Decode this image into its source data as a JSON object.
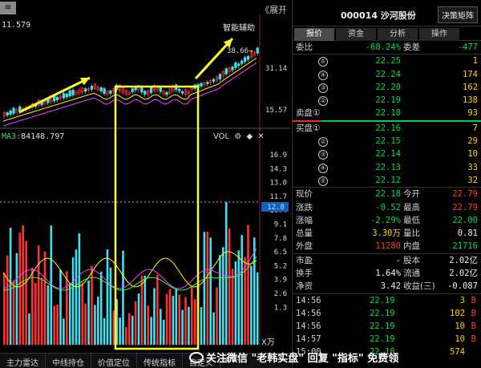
{
  "chart": {
    "menu_icon": "menu-icon",
    "expand_label": "《展开",
    "price_readout": "11.579",
    "assist_label": "智能辅助",
    "peak_label": "38.66→",
    "price_axis": [
      "31.14",
      "15.57"
    ],
    "ma_tag": "MA3:",
    "ma_value": "84148.797",
    "vol_tag": "VOL",
    "volume_axis": [
      "16.9",
      "14.3",
      "13.0",
      "11.7",
      "10.4",
      "9.1",
      "7.8",
      "6.5",
      "5.2",
      "3.9",
      "2.6",
      "1.3"
    ],
    "volume_highlight": "12.8",
    "unit_label": "X万",
    "colors": {
      "up": "#ff3030",
      "down": "#40e0f0",
      "ma1": "#ffff00",
      "ma2": "#ff40ff",
      "ma3": "#40ff40",
      "box": "#ffff30",
      "arrow": "#ffff30"
    }
  },
  "tabs": [
    "主力雷达",
    "中线持仓",
    "价值定位",
    "传统指标",
    "自定义"
  ],
  "tab_arrows": [
    "◀",
    "▶"
  ],
  "panel": {
    "title": "000014 沙河股份",
    "decision_btn": "决策矩阵",
    "tabs": [
      "报价",
      "资金",
      "分析",
      "操作"
    ],
    "ratio": {
      "label1": "委比",
      "value1": "-68.24%",
      "label2": "委差",
      "value2": "-477"
    },
    "sell": [
      {
        "n": "⑤",
        "price": "22.25",
        "vol": "1"
      },
      {
        "n": "④",
        "price": "22.24",
        "vol": "174"
      },
      {
        "n": "③",
        "price": "22.20",
        "vol": "162"
      },
      {
        "n": "②",
        "price": "22.19",
        "vol": "138"
      },
      {
        "label": "卖盘①",
        "price": "22.18",
        "vol": "93"
      }
    ],
    "buy": [
      {
        "label": "买盘①",
        "price": "22.16",
        "vol": "7"
      },
      {
        "n": "②",
        "price": "22.15",
        "vol": "29"
      },
      {
        "n": "③",
        "price": "22.14",
        "vol": "10"
      },
      {
        "n": "④",
        "price": "22.13",
        "vol": "33"
      },
      {
        "n": "⑤",
        "price": "22.12",
        "vol": "32"
      }
    ],
    "stats": [
      {
        "l1": "现价",
        "v1": "22.18",
        "c1": "green",
        "l2": "今开",
        "v2": "22.79",
        "c2": "red"
      },
      {
        "l1": "涨跌",
        "v1": "-0.52",
        "c1": "green",
        "l2": "最高",
        "v2": "22.79",
        "c2": "red"
      },
      {
        "l1": "涨幅",
        "v1": "-2.29%",
        "c1": "green",
        "l2": "最低",
        "v2": "22.00",
        "c2": "green"
      },
      {
        "l1": "总量",
        "v1": "3.30万",
        "c1": "yellow",
        "l2": "量比",
        "v2": "0.81",
        "c2": "white"
      },
      {
        "l1": "外盘",
        "v1": "11280",
        "c1": "red",
        "l2": "内盘",
        "v2": "21716",
        "c2": "green"
      }
    ],
    "fund": [
      {
        "l1": "市盈",
        "v1": "-",
        "c1": "white",
        "l2": "股本",
        "v2": "2.02亿",
        "c2": "white"
      },
      {
        "l1": "换手",
        "v1": "1.64%",
        "c1": "white",
        "l2": "流通",
        "v2": "2.02亿",
        "c2": "white"
      },
      {
        "l1": "净资",
        "v1": "3.42",
        "c1": "white",
        "l2": "收益(三)",
        "v2": "-0.087",
        "c2": "white"
      }
    ],
    "trades": [
      {
        "time": "14:56",
        "price": "22.19",
        "vol": "3",
        "side": "B"
      },
      {
        "time": "14:56",
        "price": "22.19",
        "vol": "102",
        "side": "B"
      },
      {
        "time": "14:56",
        "price": "22.19",
        "vol": "10",
        "side": "B"
      },
      {
        "time": "14:57",
        "price": "22.19",
        "vol": "10",
        "side": "B"
      },
      {
        "time": "15:00",
        "price": "22.18",
        "vol": "574",
        "side": ""
      }
    ]
  },
  "watermark": "关注微信 \"老韩实盘\" 回复 \"指标\" 免费领"
}
